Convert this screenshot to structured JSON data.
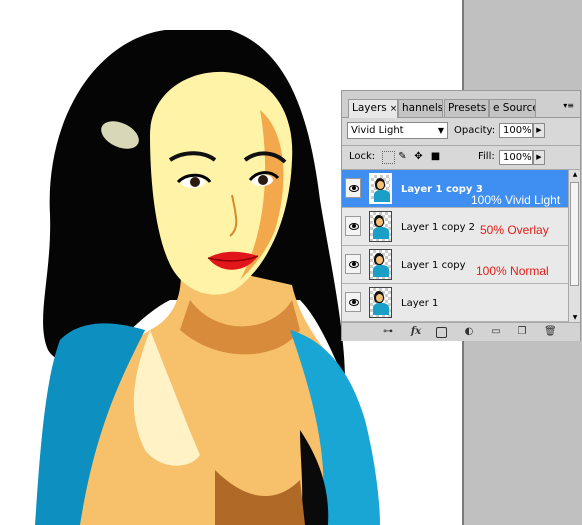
{
  "panel": {
    "tabs": [
      {
        "label": "Layers",
        "close": "×"
      },
      {
        "label": "hannels"
      },
      {
        "label": "Presets"
      },
      {
        "label": "e Source"
      }
    ],
    "blend_mode": "Vivid Light",
    "opacity_label": "Opacity:",
    "opacity_value": "100%",
    "lock_label": "Lock:",
    "fill_label": "Fill:",
    "fill_value": "100%",
    "layers": [
      {
        "name": "Layer 1 copy 3",
        "selected": true
      },
      {
        "name": "Layer 1 copy 2",
        "selected": false
      },
      {
        "name": "Layer 1 copy",
        "selected": false
      },
      {
        "name": "Layer 1",
        "selected": false
      }
    ],
    "bottom_icons": [
      "link-icon",
      "fx-icon",
      "mask-icon",
      "adjustment-icon",
      "group-icon",
      "new-layer-icon",
      "trash-icon"
    ]
  },
  "annotations": [
    {
      "text": "100% Vivid Light",
      "color": "#ffffff"
    },
    {
      "text": "50% Overlay",
      "color": "#e0201a"
    },
    {
      "text": "100% Normal",
      "color": "#e0201a"
    }
  ],
  "colors": {
    "selected_layer": "#3f8ff2",
    "canvas_gray": "#c0c0c0",
    "note_red": "#e0201a"
  }
}
